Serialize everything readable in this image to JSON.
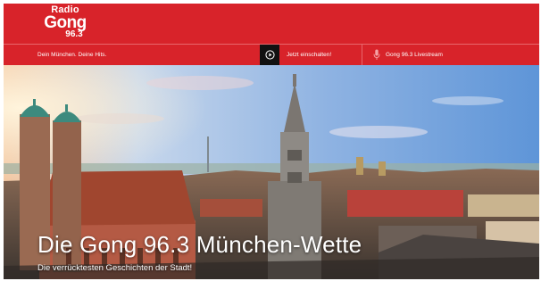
{
  "header": {
    "logo": {
      "line1": "Radio",
      "line2": "Gong",
      "line3": "96.3"
    },
    "slogan": "Dein München. Deine Hits.",
    "listen_label": "Jetzt einschalten!",
    "livestream_label": "Gong 96.3 Livestream"
  },
  "hero": {
    "title": "Die Gong 96.3 München-Wette",
    "subtitle": "Die verrücktesten Geschichten der Stadt!"
  },
  "colors": {
    "brand_red": "#d8232a",
    "play_button_bg": "#111111"
  },
  "icons": {
    "play": "play-circle-icon",
    "mic": "microphone-icon"
  }
}
